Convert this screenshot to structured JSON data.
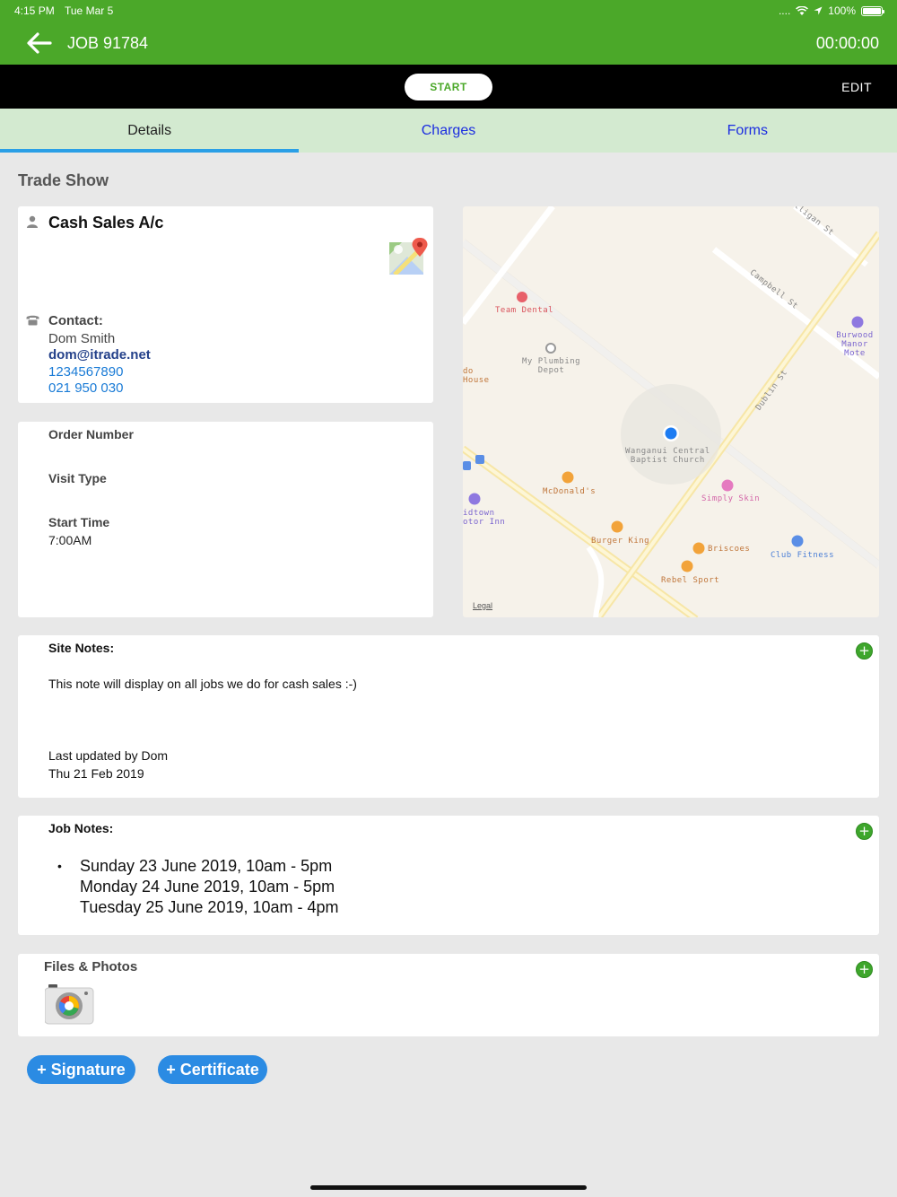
{
  "status": {
    "time": "4:15 PM",
    "date": "Tue Mar 5",
    "signal": "....",
    "battery": "100%",
    "battery_level": 1.0
  },
  "nav": {
    "title": "JOB 91784",
    "timer": "00:00:00"
  },
  "actions": {
    "start": "START",
    "edit": "EDIT"
  },
  "tabs": [
    {
      "label": "Details"
    },
    {
      "label": "Charges"
    },
    {
      "label": "Forms"
    }
  ],
  "section_title": "Trade Show",
  "customer": {
    "name": "Cash Sales A/c",
    "contact_label": "Contact:",
    "contact_name": "Dom Smith",
    "email": "dom@itrade.net",
    "phone1": "1234567890",
    "phone2": "021 950 030"
  },
  "info": {
    "order_number_label": "Order Number",
    "visit_type_label": "Visit Type",
    "start_time_label": "Start Time",
    "start_time_value": "7:00AM"
  },
  "map": {
    "streets": [
      "Mulligan St",
      "Campbell St",
      "Dublin St"
    ],
    "places": {
      "team_dental": "Team Dental",
      "plumbing_1": "My Plumbing",
      "plumbing_2": "Depot",
      "house_1": "do",
      "house_2": "House",
      "church_1": "Wanganui Central",
      "church_2": "Baptist Church",
      "mcdonalds": "McDonald's",
      "midtown_1": "idtown",
      "midtown_2": "otor Inn",
      "simply_skin": "Simply Skin",
      "burger_king": "Burger King",
      "briscoes": "Briscoes",
      "rebel_sport": "Rebel Sport",
      "club_fitness": "Club Fitness",
      "burwood_1": "Burwood",
      "burwood_2": "Manor Mote"
    },
    "legal": "Legal"
  },
  "site_notes": {
    "title": "Site Notes:",
    "body": "This note will display on all jobs we do for cash sales :-)",
    "updated_by": "Last updated by Dom",
    "updated_date": "Thu 21 Feb 2019"
  },
  "job_notes": {
    "title": "Job Notes:",
    "bullet": "•",
    "lines": [
      "Sunday 23 June 2019, 10am - 5pm",
      "Monday 24 June 2019, 10am - 5pm",
      "Tuesday 25 June 2019, 10am - 4pm"
    ]
  },
  "files": {
    "title": "Files & Photos"
  },
  "add_symbol": "+",
  "buttons": {
    "signature": "+ Signature",
    "certificate": "+ Certificate"
  },
  "colors": {
    "brand_green": "#4ba829",
    "tab_bg": "#d3ead0",
    "tab_indicator": "#2a9fe6",
    "link_blue": "#1a7bd6",
    "button_blue": "#2b8be3"
  }
}
